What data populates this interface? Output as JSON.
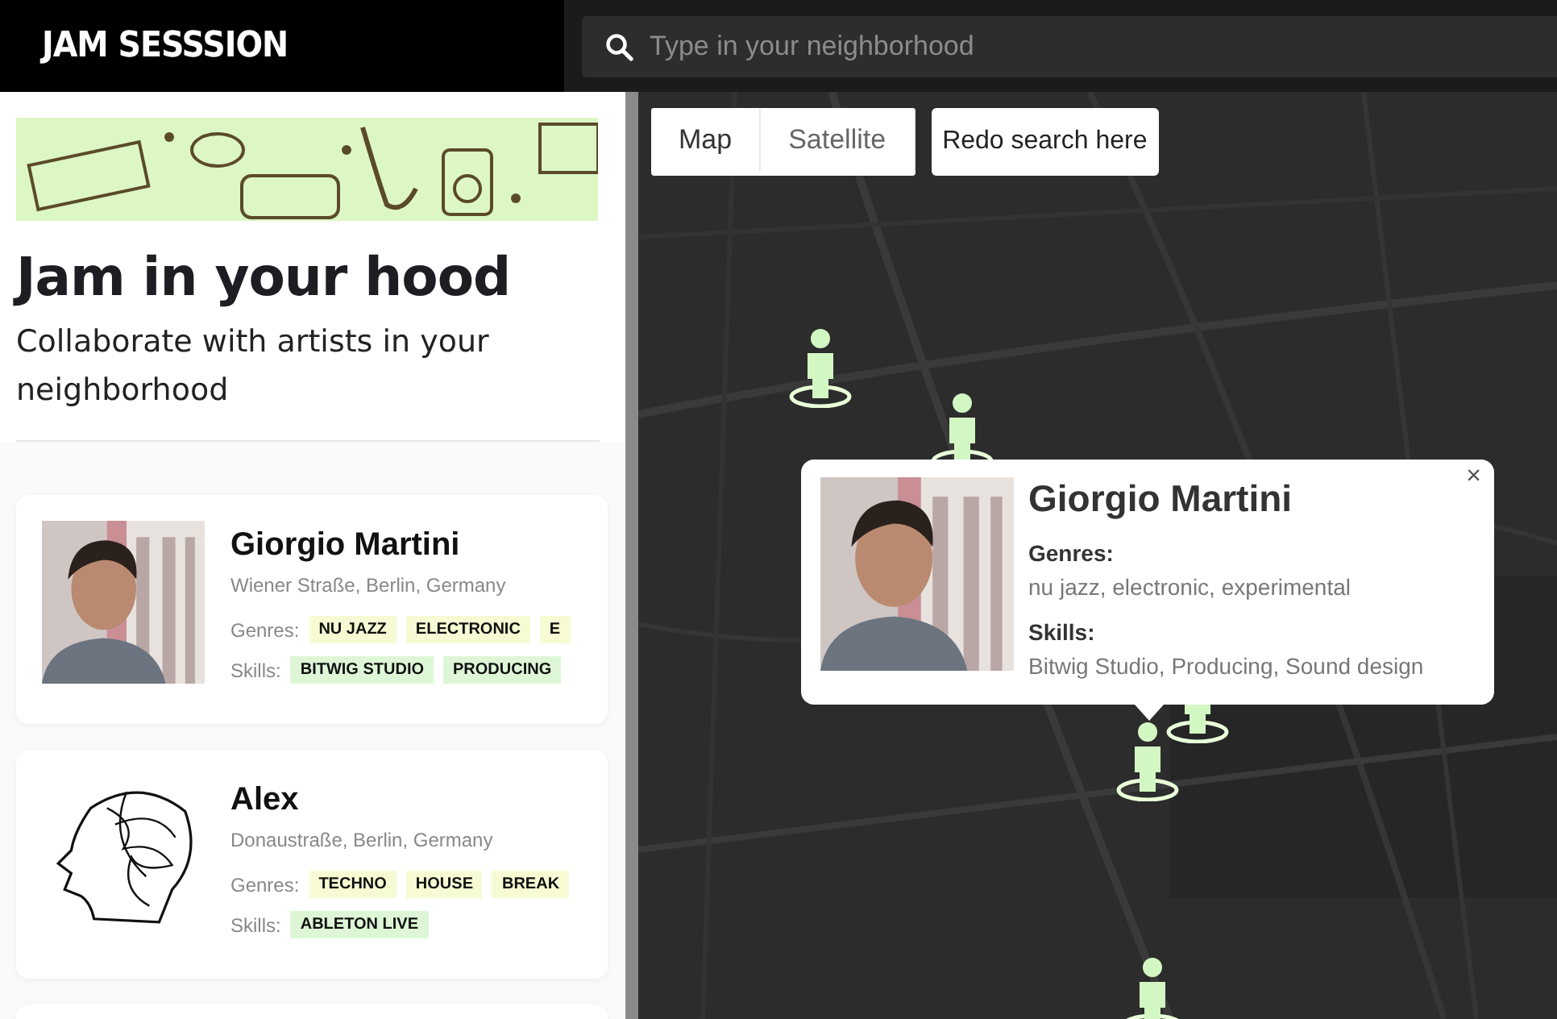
{
  "header": {
    "logo": "JAM SESSSION",
    "search": {
      "placeholder": "Type in your neighborhood"
    }
  },
  "sidebar": {
    "title": "Jam in your hood",
    "subtitle": "Collaborate with artists in your neighborhood",
    "artists": [
      {
        "name": "Giorgio Martini",
        "address": "Wiener Straße, Berlin, Germany",
        "genres_label": "Genres:",
        "genres": [
          "NU JAZZ",
          "ELECTRONIC",
          "E"
        ],
        "skills_label": "Skills:",
        "skills": [
          "BITWIG STUDIO",
          "PRODUCING"
        ]
      },
      {
        "name": "Alex",
        "address": "Donaustraße, Berlin, Germany",
        "genres_label": "Genres:",
        "genres": [
          "TECHNO",
          "HOUSE",
          "BREAK"
        ],
        "skills_label": "Skills:",
        "skills": [
          "ABLETON LIVE"
        ]
      }
    ]
  },
  "map": {
    "map_types": [
      {
        "label": "Map",
        "selected": true
      },
      {
        "label": "Satellite",
        "selected": false
      }
    ],
    "redo_button": "Redo search here",
    "popup": {
      "name": "Giorgio Martini",
      "close": "×",
      "genres_label": "Genres:",
      "genres": "nu jazz, electronic, experimental",
      "skills_label": "Skills:",
      "skills": "Bitwig Studio, Producing, Sound design"
    }
  }
}
